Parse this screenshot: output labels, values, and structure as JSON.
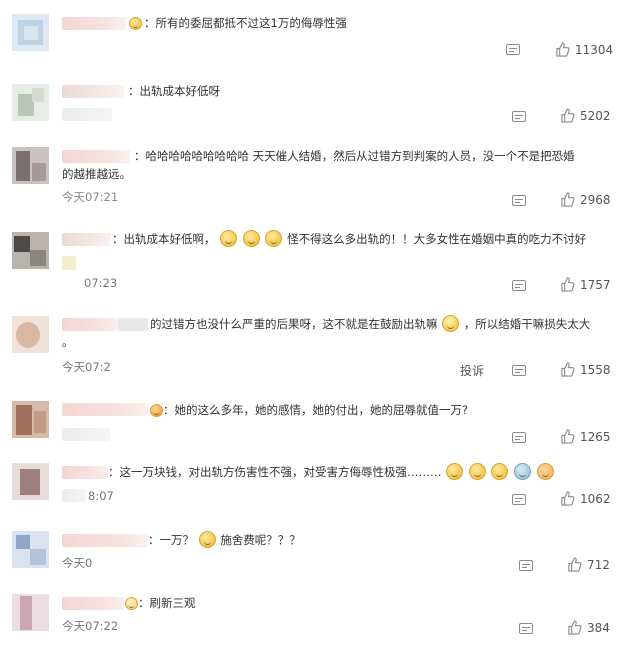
{
  "comments": [
    {
      "text": "所有的委屈都抵不过这1万的侮辱性强",
      "time": "",
      "likes": "11304"
    },
    {
      "text": "出轨成本好低呀",
      "time": "",
      "likes": "5202"
    },
    {
      "text_line1": "哈哈哈哈哈哈哈哈哈 天天催人结婚，然后从过错方到判案的人员，没一个不是把恐婚",
      "text_line2": "的越推越远。",
      "time": "今天07:21",
      "likes": "2968"
    },
    {
      "text_a": "出轨成本好低啊，",
      "text_b": "怪不得这么多出轨的！！大多女性在婚姻中真的吃力不讨好",
      "time": "07:23",
      "likes": "1757"
    },
    {
      "text_a": "的过错方也没什么严重的后果呀，这不就是在鼓励出轨嘛",
      "text_b": "，所以结婚干嘛损失太大",
      "text_line2": "。",
      "time": "今天07:2",
      "report": "投诉",
      "likes": "1558"
    },
    {
      "text": "她的这么多年，她的感情，她的付出，她的屈辱就值一万?",
      "time": "",
      "likes": "1265"
    },
    {
      "text": "：这一万块钱，对出轨方伤害性不强，对受害方侮辱性极强………",
      "time": "8:07",
      "likes": "1062"
    },
    {
      "text_a": "：一万？",
      "text_b": "施舍费呢？？？",
      "time": "今天0",
      "likes": "712"
    },
    {
      "text": "刷新三观",
      "time": "今天07:22",
      "likes": "384"
    }
  ],
  "icons": {
    "reply": "comment-icon",
    "like": "thumbs-up-icon",
    "emoji": "smile-emoji-icon"
  }
}
